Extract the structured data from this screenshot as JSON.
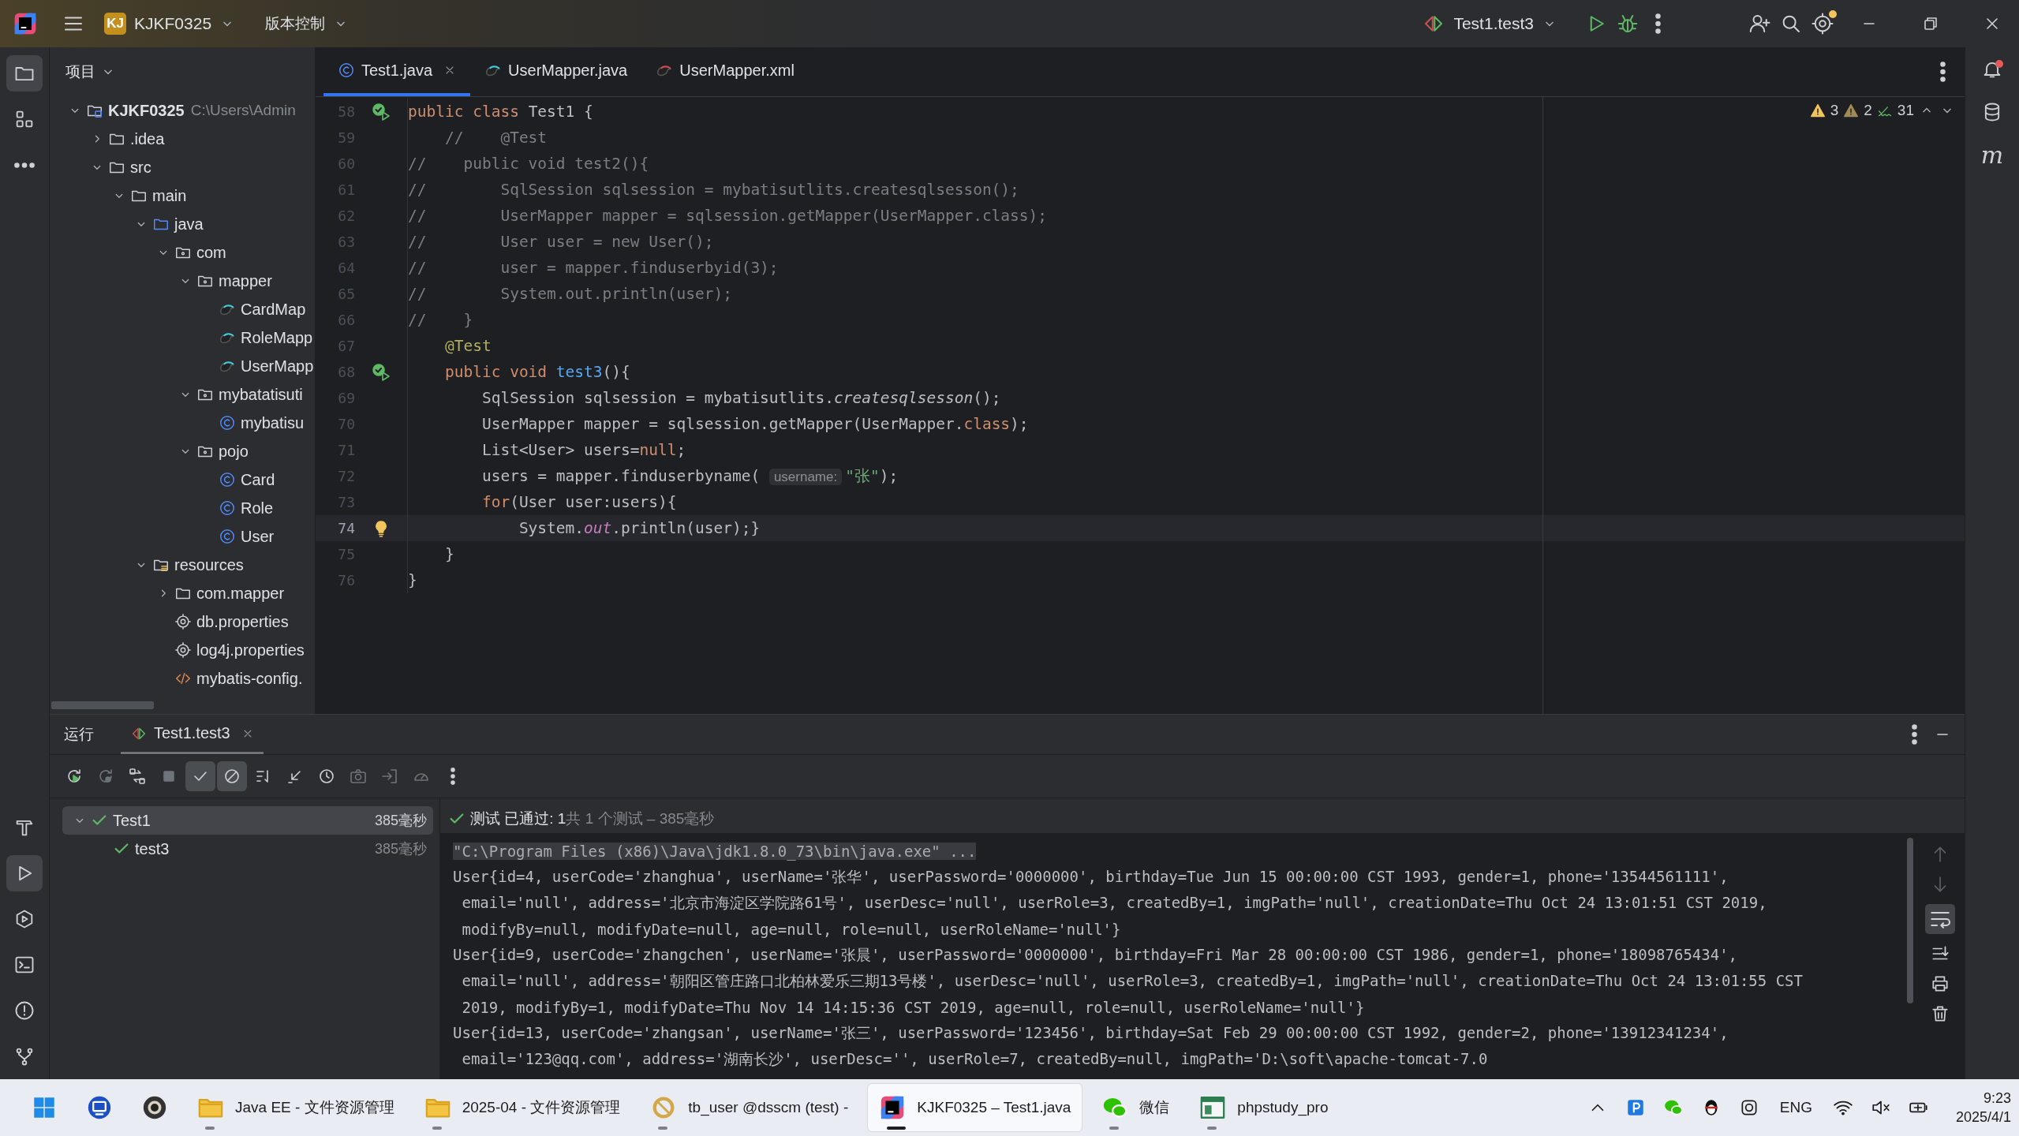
{
  "title_bar": {
    "project_badge": "KJ",
    "project": "KJKF0325",
    "vcs": "版本控制",
    "run_config": "Test1.test3",
    "settings_badge": true
  },
  "left_strip": {
    "top": [
      {
        "selected": true
      },
      {
        "selected": false
      },
      {
        "selected": false
      }
    ],
    "bottom": [
      {
        "selected": false
      },
      {
        "selected": true
      },
      {
        "selected": false
      },
      {
        "selected": false
      },
      {
        "selected": false
      },
      {
        "selected": false
      }
    ]
  },
  "project_panel": {
    "title": "项目",
    "tree": [
      {
        "label": "KJKF0325",
        "hint": "C:\\Users\\Admin",
        "kind": "module",
        "expanded": true,
        "children": [
          {
            "label": ".idea",
            "kind": "folder",
            "expanded": false
          },
          {
            "label": "src",
            "kind": "folder",
            "expanded": true,
            "children": [
              {
                "label": "main",
                "kind": "folder",
                "expanded": true,
                "children": [
                  {
                    "label": "java",
                    "kind": "source",
                    "expanded": true,
                    "children": [
                      {
                        "label": "com",
                        "kind": "package",
                        "expanded": true,
                        "children": [
                          {
                            "label": "mapper",
                            "kind": "package",
                            "expanded": true,
                            "children": [
                              {
                                "label": "CardMap",
                                "kind": "mapper"
                              },
                              {
                                "label": "RoleMapp",
                                "kind": "mapper"
                              },
                              {
                                "label": "UserMapp",
                                "kind": "mapper"
                              }
                            ]
                          },
                          {
                            "label": "mybatatisuti",
                            "kind": "package",
                            "expanded": true,
                            "children": [
                              {
                                "label": "mybatisu",
                                "kind": "class"
                              }
                            ]
                          },
                          {
                            "label": "pojo",
                            "kind": "package",
                            "expanded": true,
                            "children": [
                              {
                                "label": "Card",
                                "kind": "class"
                              },
                              {
                                "label": "Role",
                                "kind": "class"
                              },
                              {
                                "label": "User",
                                "kind": "class"
                              }
                            ]
                          }
                        ]
                      }
                    ]
                  },
                  {
                    "label": "resources",
                    "kind": "resources",
                    "expanded": true,
                    "children": [
                      {
                        "label": "com.mapper",
                        "kind": "folder",
                        "expanded": false
                      },
                      {
                        "label": "db.properties",
                        "kind": "config"
                      },
                      {
                        "label": "log4j.properties",
                        "kind": "config"
                      },
                      {
                        "label": "mybatis-config.",
                        "kind": "xml"
                      }
                    ]
                  }
                ]
              }
            ]
          }
        ]
      }
    ]
  },
  "editor": {
    "tabs": [
      {
        "label": "Test1.java",
        "kind": "class",
        "selected": true
      },
      {
        "label": "UserMapper.java",
        "kind": "mapper",
        "selected": false
      },
      {
        "label": "UserMapper.xml",
        "kind": "mapperxml",
        "selected": false
      }
    ],
    "inspections": {
      "warnings": "3",
      "weak_warnings": "2",
      "passed": "31"
    },
    "lines": [
      {
        "number": "58",
        "kind": "test",
        "current": false,
        "tokens": [
          {
            "kind": "keyword",
            "text": "public class "
          },
          {
            "kind": "plain",
            "text": "Test1 {"
          }
        ]
      },
      {
        "number": "59",
        "kind": "plain",
        "current": false,
        "tokens": [
          {
            "kind": "comment",
            "text": "    //    @Test"
          }
        ]
      },
      {
        "number": "60",
        "kind": "plain",
        "current": false,
        "tokens": [
          {
            "kind": "comment",
            "text": "//    public void test2(){"
          }
        ]
      },
      {
        "number": "61",
        "kind": "plain",
        "current": false,
        "tokens": [
          {
            "kind": "comment",
            "text": "//        SqlSession sqlsession = mybatisutlits.createsqlsesson();"
          }
        ]
      },
      {
        "number": "62",
        "kind": "plain",
        "current": false,
        "tokens": [
          {
            "kind": "comment",
            "text": "//        UserMapper mapper = sqlsession.getMapper(UserMapper.class);"
          }
        ]
      },
      {
        "number": "63",
        "kind": "plain",
        "current": false,
        "tokens": [
          {
            "kind": "comment",
            "text": "//        User user = new User();"
          }
        ]
      },
      {
        "number": "64",
        "kind": "plain",
        "current": false,
        "tokens": [
          {
            "kind": "comment",
            "text": "//        user = mapper.finduserbyid(3);"
          }
        ]
      },
      {
        "number": "65",
        "kind": "plain",
        "current": false,
        "tokens": [
          {
            "kind": "comment",
            "text": "//        System.out.println(user);"
          }
        ]
      },
      {
        "number": "66",
        "kind": "plain",
        "current": false,
        "tokens": [
          {
            "kind": "comment",
            "text": "//    }"
          }
        ]
      },
      {
        "number": "67",
        "kind": "plain",
        "current": false,
        "tokens": [
          {
            "kind": "annotation",
            "text": "    @Test"
          }
        ]
      },
      {
        "number": "68",
        "kind": "test",
        "current": false,
        "tokens": [
          {
            "kind": "keyword",
            "text": "    public void "
          },
          {
            "kind": "method",
            "text": "test3"
          },
          {
            "kind": "plain",
            "text": "(){"
          }
        ]
      },
      {
        "number": "69",
        "kind": "plain",
        "current": false,
        "tokens": [
          {
            "kind": "plain",
            "text": "        SqlSession sqlsession = mybatisutlits."
          },
          {
            "kind": "italic",
            "text": "createsqlsesson"
          },
          {
            "kind": "plain",
            "text": "();"
          }
        ]
      },
      {
        "number": "70",
        "kind": "plain",
        "current": false,
        "tokens": [
          {
            "kind": "plain",
            "text": "        UserMapper mapper = sqlsession.getMapper(UserMapper."
          },
          {
            "kind": "keyword",
            "text": "class"
          },
          {
            "kind": "plain",
            "text": ");"
          }
        ]
      },
      {
        "number": "71",
        "kind": "plain",
        "current": false,
        "tokens": [
          {
            "kind": "plain",
            "text": "        List<User> users="
          },
          {
            "kind": "keyword",
            "text": "null"
          },
          {
            "kind": "plain",
            "text": ";"
          }
        ]
      },
      {
        "number": "72",
        "kind": "plain",
        "current": false,
        "tokens": [
          {
            "kind": "plain",
            "text": "        users = mapper.finduserbyname( "
          },
          {
            "kind": "hint",
            "text": "username:"
          },
          {
            "kind": "string",
            "text": "\"张\""
          },
          {
            "kind": "plain",
            "text": ");"
          }
        ]
      },
      {
        "number": "73",
        "kind": "plain",
        "current": false,
        "tokens": [
          {
            "kind": "keyword",
            "text": "        for"
          },
          {
            "kind": "plain",
            "text": "(User user:users){"
          }
        ]
      },
      {
        "number": "74",
        "kind": "bulb",
        "current": true,
        "tokens": [
          {
            "kind": "plain",
            "text": "            System."
          },
          {
            "kind": "field",
            "text": "out"
          },
          {
            "kind": "plain",
            "text": ".println(user);}"
          }
        ]
      },
      {
        "number": "75",
        "kind": "plain",
        "current": false,
        "tokens": [
          {
            "kind": "plain",
            "text": "    }"
          }
        ]
      },
      {
        "number": "76",
        "kind": "plain",
        "current": false,
        "tokens": [
          {
            "kind": "plain",
            "text": "}"
          }
        ]
      }
    ]
  },
  "right_strip": {
    "notifications_badge": true,
    "letter": "m"
  },
  "run_panel": {
    "title": "运行",
    "tabs": [
      {
        "label": "Test1.test3",
        "selected": true
      }
    ],
    "toolbar": [
      {
        "selected": false,
        "disabled": false
      },
      {
        "selected": false,
        "disabled": true
      },
      {
        "selected": false,
        "disabled": false
      },
      {
        "selected": false,
        "disabled": true
      },
      {
        "selected": true,
        "disabled": false
      },
      {
        "selected": true,
        "disabled": false
      },
      {
        "selected": false,
        "disabled": false
      },
      {
        "selected": false,
        "disabled": false
      },
      {
        "selected": false,
        "disabled": false
      },
      {
        "selected": false,
        "disabled": true
      },
      {
        "selected": false,
        "disabled": true
      },
      {
        "selected": false,
        "disabled": true
      },
      {
        "selected": false,
        "disabled": false
      }
    ],
    "tree": [
      {
        "label": "Test1",
        "time": "385毫秒",
        "expanded": true,
        "selected": true,
        "children": [
          {
            "label": "test3",
            "time": "385毫秒",
            "selected": false
          }
        ]
      }
    ],
    "status": {
      "label": "测试 已通过: 1",
      "detail": "共 1 个测试 – 385毫秒"
    },
    "console": [
      {
        "kind": "command",
        "text": "\"C:\\Program Files (x86)\\Java\\jdk1.8.0_73\\bin\\java.exe\" ..."
      },
      {
        "kind": "output",
        "text": "User{id=4, userCode='zhanghua', userName='张华', userPassword='0000000', birthday=Tue Jun 15 00:00:00 CST 1993, gender=1, phone='13544561111',"
      },
      {
        "kind": "output",
        "text": " email='null', address='北京市海淀区学院路61号', userDesc='null', userRole=3, createdBy=1, imgPath='null', creationDate=Thu Oct 24 13:01:51 CST 2019,"
      },
      {
        "kind": "output",
        "text": " modifyBy=null, modifyDate=null, age=null, role=null, userRoleName='null'}"
      },
      {
        "kind": "output",
        "text": "User{id=9, userCode='zhangchen', userName='张晨', userPassword='0000000', birthday=Fri Mar 28 00:00:00 CST 1986, gender=1, phone='18098765434',"
      },
      {
        "kind": "output",
        "text": " email='null', address='朝阳区管庄路口北柏林爱乐三期13号楼', userDesc='null', userRole=3, createdBy=1, imgPath='null', creationDate=Thu Oct 24 13:01:55 CST"
      },
      {
        "kind": "output",
        "text": " 2019, modifyBy=1, modifyDate=Thu Nov 14 14:15:36 CST 2019, age=null, role=null, userRoleName='null'}"
      },
      {
        "kind": "output",
        "text": "User{id=13, userCode='zhangsan', userName='张三', userPassword='123456', birthday=Sat Feb 29 00:00:00 CST 1992, gender=2, phone='13912341234',"
      },
      {
        "kind": "output",
        "text": " email='123@qq.com', address='湖南长沙', userDesc='', userRole=7, createdBy=null, imgPath='D:\\soft\\apache-tomcat-7.0"
      }
    ]
  },
  "taskbar": {
    "windows": [
      {
        "kind": "folder",
        "label": "Java EE - 文件资源管理",
        "running": true,
        "selected": false
      },
      {
        "kind": "folder",
        "label": "2025-04 - 文件资源管理",
        "running": true,
        "selected": false
      },
      {
        "kind": "database",
        "label": "tb_user @dsscm (test) -",
        "running": true,
        "selected": false
      },
      {
        "kind": "ide",
        "label": "KJKF0325 – Test1.java",
        "running": true,
        "selected": true
      },
      {
        "kind": "chat",
        "label": "微信",
        "running": true,
        "selected": false
      },
      {
        "kind": "window",
        "label": "phpstudy_pro",
        "running": true,
        "selected": false
      }
    ],
    "tray": {
      "language": "ENG",
      "time": "9:23",
      "date": "2025/4/1"
    }
  }
}
